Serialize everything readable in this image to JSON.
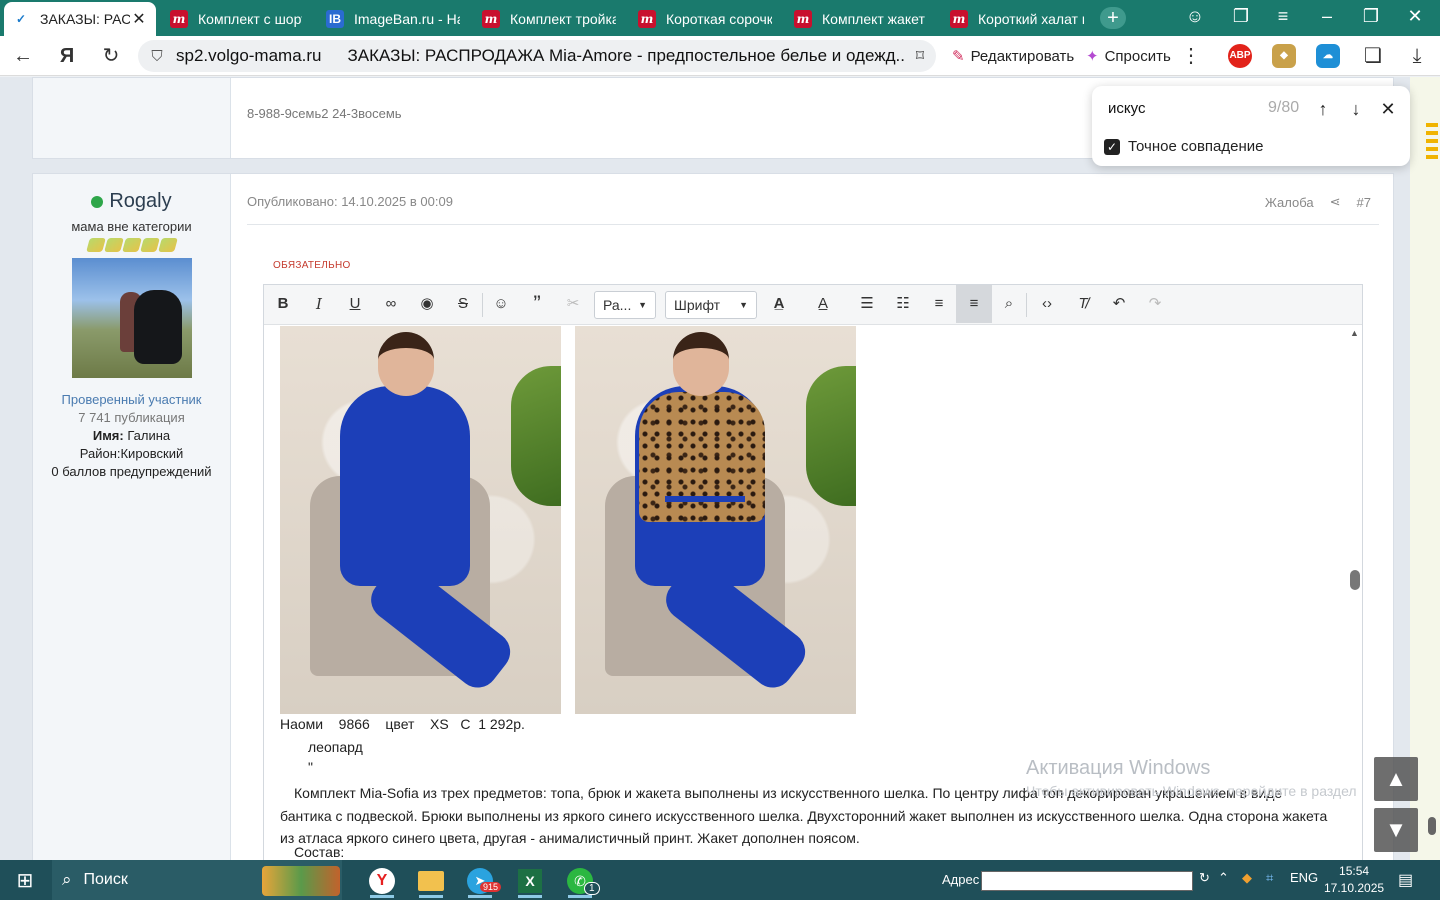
{
  "browser": {
    "tabs": [
      {
        "title": "ЗАКАЗЫ: РАСП",
        "icon": "yandex-icon",
        "active": true
      },
      {
        "title": "Комплект с шорта",
        "icon": "mia-amore-icon"
      },
      {
        "title": "ImageBan.ru - Над",
        "icon": "imageban-icon"
      },
      {
        "title": "Комплект тройка",
        "icon": "mia-amore-icon"
      },
      {
        "title": "Короткая сорочка",
        "icon": "mia-amore-icon"
      },
      {
        "title": "Комплект жакет и",
        "icon": "mia-amore-icon"
      },
      {
        "title": "Короткий халат на",
        "icon": "mia-amore-icon"
      }
    ],
    "new_tab_glyph": "+",
    "address": {
      "host": "sp2.volgo-mama.ru",
      "page_title": "ЗАКАЗЫ: РАСПРОДАЖА Mia-Amore - предпостельное белье и одежд..."
    },
    "edit_label": "Редактировать",
    "ask_label": "Спросить",
    "abp_label": "ABP"
  },
  "find_bar": {
    "query": "искус",
    "count": "9/80",
    "exact_match_label": "Точное совпадение",
    "exact_match_checked": true
  },
  "prev_post": {
    "phone": "8-988-9семь2 24-3восемь"
  },
  "post": {
    "user": {
      "name": "Rogaly",
      "online": true,
      "rank": "мама вне категории",
      "status": "Проверенный участник",
      "count": "7 741 публикация",
      "name_label": "Имя:",
      "name_value": "Галина",
      "district": "Район:Кировский",
      "warnings": "0 баллов предупреждений"
    },
    "published": "Опубликовано: 14.10.2025 в 00:09",
    "report_label": "Жалоба",
    "post_number": "#7",
    "required_label": "ОБЯЗАТЕЛЬНО"
  },
  "editor": {
    "size_select": "Ра...",
    "font_select": "Шрифт",
    "lines": {
      "product": "Наоми    9866    цвет    XS   С  1 292р.",
      "color": "леопард",
      "quote": "\""
    },
    "description": "Комплект Mia-Sofia из трех предметов: топа, брюк и жакета выполнены из искусственного шелка. По центру лифа топ декорирован украшением в виде бантика с подвеской. Брюки выполнены из яркого синего искусственного шелка. Двухсторонний жакет выполнен из искусственного шелка. Одна сторона жакета из атласа яркого синего цвета, другая - анималистичный принт. Жакет дополнен поясом.",
    "composition_label": "Состав:"
  },
  "watermark": {
    "title": "Активация Windows",
    "subtitle": "Чтобы активировать Windows, перейдите в раздел"
  },
  "taskbar": {
    "search_label": "Поиск",
    "telegram_badge": "915",
    "whatsapp_badge": "1",
    "address_label": "Адрес",
    "lang": "ENG",
    "time": "15:54",
    "date": "17.10.2025"
  },
  "colors": {
    "tabstrip": "#1a7a6d",
    "taskbar": "#1f4f59",
    "accent_red": "#c53b2e",
    "online_green": "#2ea64a"
  }
}
